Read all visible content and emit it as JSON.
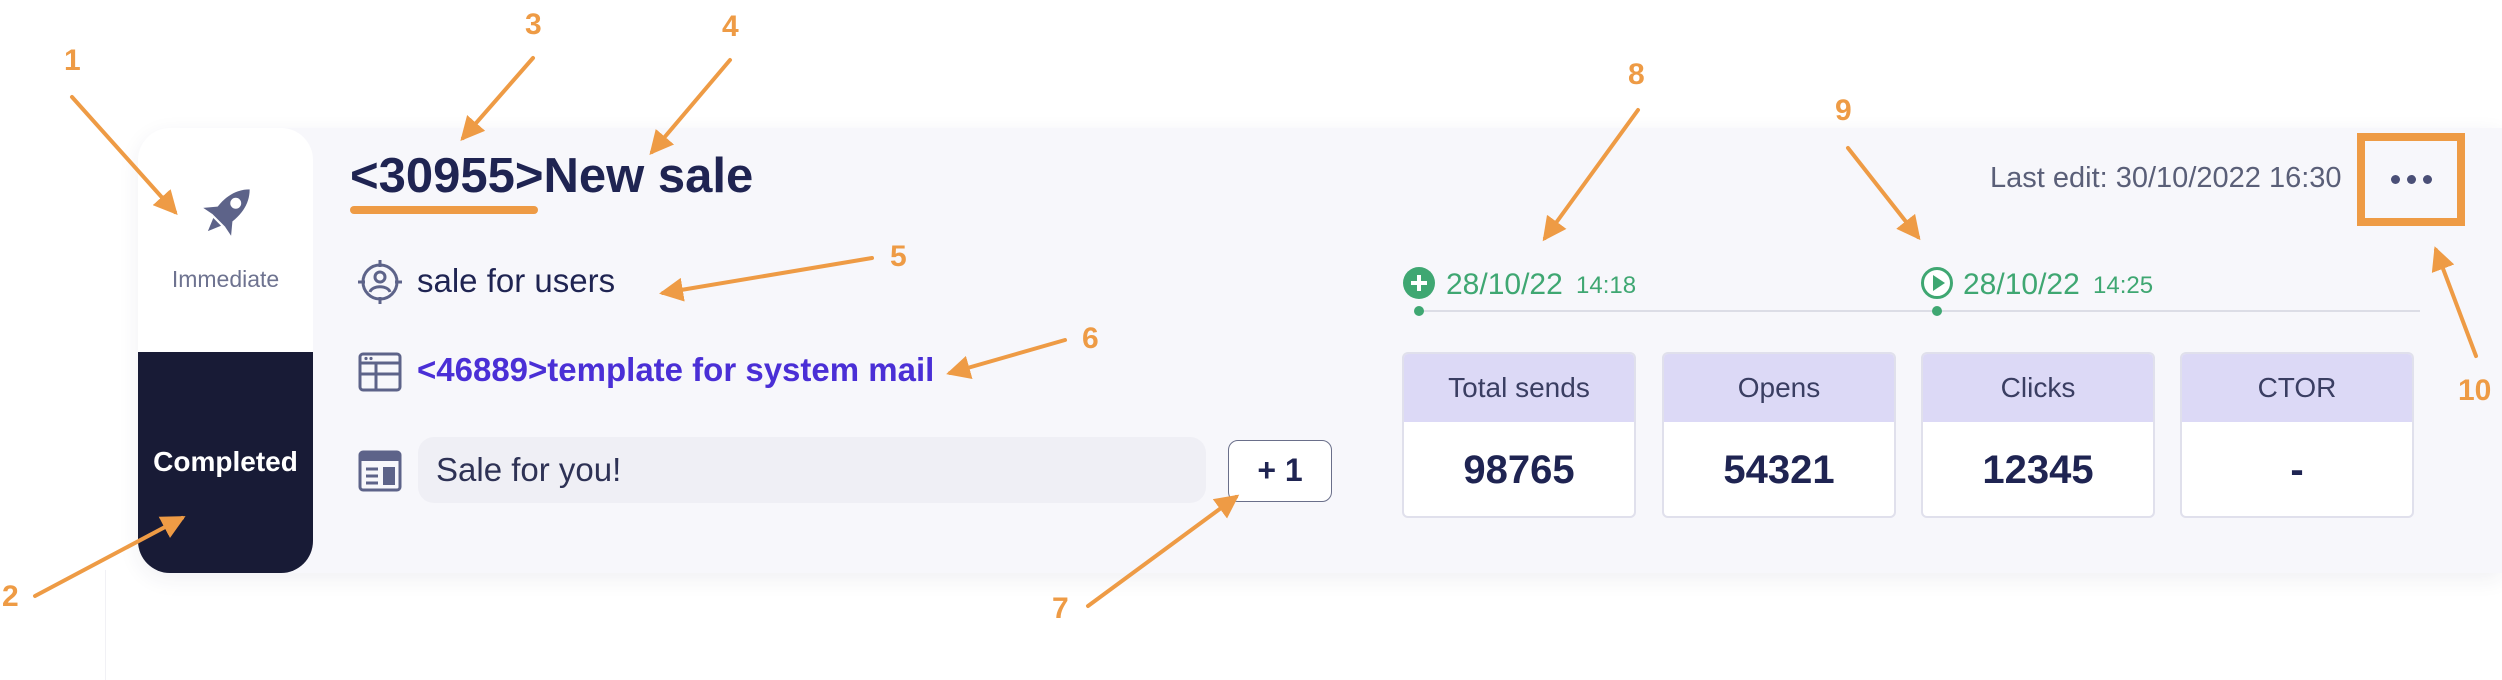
{
  "campaign": {
    "id": "<30955>",
    "name": "New sale",
    "schedule_type": "Immediate",
    "status": "Completed",
    "audience": "sale for users",
    "template": "<46889>template for system mail",
    "subject": "Sale for you!",
    "more_subjects": "+ 1",
    "last_edit": "Last edit: 30/10/2022 16:30"
  },
  "timeline": {
    "created": {
      "date": "28/10/22",
      "time": "14:18",
      "icon": "plus-circle-icon"
    },
    "started": {
      "date": "28/10/22",
      "time": "14:25",
      "icon": "play-circle-icon"
    }
  },
  "stats": [
    {
      "label": "Total sends",
      "value": "98765"
    },
    {
      "label": "Opens",
      "value": "54321"
    },
    {
      "label": "Clicks",
      "value": "12345"
    },
    {
      "label": "CTOR",
      "value": "-"
    }
  ],
  "annotations": [
    "1",
    "2",
    "3",
    "4",
    "5",
    "6",
    "7",
    "8",
    "9",
    "10"
  ],
  "icons": {
    "schedule": "rocket-icon",
    "audience": "audience-target-icon",
    "template": "template-icon",
    "subject": "subject-layout-icon",
    "menu": "more-dots-icon"
  },
  "colors": {
    "dark_status_bg": "#181b36",
    "accent_annotation": "#ee9b45",
    "template_link": "#4a2fd6",
    "timeline_green": "#3fa772",
    "stat_header_bg": "#dcd9f6",
    "title_text": "#1f2452"
  }
}
